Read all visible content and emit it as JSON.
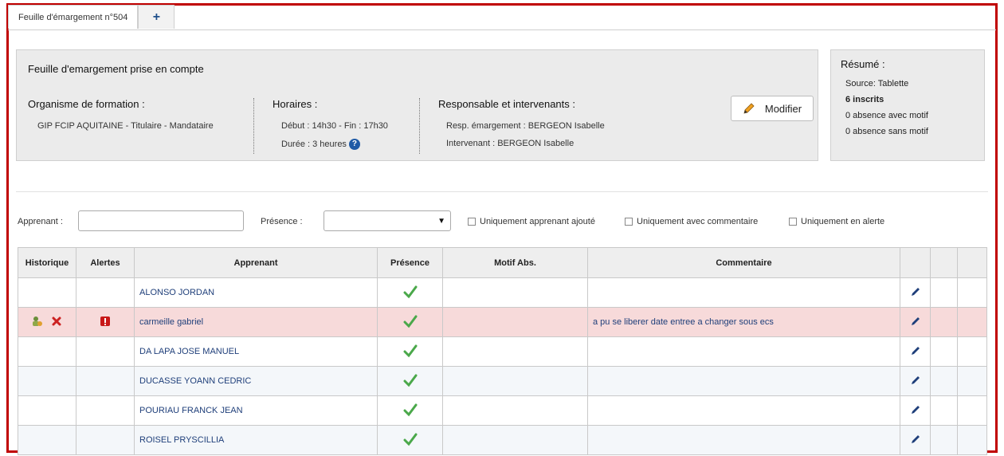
{
  "tabs": [
    {
      "label": "Feuille d'émargement n°504"
    },
    {
      "label": "+"
    }
  ],
  "info": {
    "title": "Feuille d'emargement prise en compte",
    "organisme": {
      "heading": "Organisme de formation :",
      "value": "GIP FCIP AQUITAINE - Titulaire - Mandataire"
    },
    "horaires": {
      "heading": "Horaires :",
      "debut_fin": "Début : 14h30 - Fin : 17h30",
      "duree": "Durée : 3 heures"
    },
    "responsable": {
      "heading": "Responsable et intervenants :",
      "resp": "Resp. émargement : BERGEON Isabelle",
      "intervenant": "Intervenant : BERGEON Isabelle"
    },
    "modify_label": "Modifier"
  },
  "summary": {
    "title": "Résumé :",
    "source": "Source: Tablette",
    "inscrits": "6 inscrits",
    "abs_motif": "0 absence avec motif",
    "abs_sans_motif": "0 absence sans motif"
  },
  "filters": {
    "apprenant_label": "Apprenant :",
    "apprenant_value": "",
    "presence_label": "Présence :",
    "presence_value": "",
    "check_ajoute": "Uniquement apprenant ajouté",
    "check_commentaire": "Uniquement avec commentaire",
    "check_alerte": "Uniquement en alerte"
  },
  "table": {
    "headers": [
      "Historique",
      "Alertes",
      "Apprenant",
      "Présence",
      "Motif Abs.",
      "Commentaire",
      "",
      "",
      ""
    ],
    "rows": [
      {
        "name": "ALONSO JORDAN",
        "comment": ""
      },
      {
        "name": "carmeille gabriel",
        "comment": "a pu se liberer date entree a changer sous ecs"
      },
      {
        "name": "DA LAPA JOSE MANUEL",
        "comment": ""
      },
      {
        "name": "DUCASSE YOANN CEDRIC",
        "comment": ""
      },
      {
        "name": "POURIAU FRANCK JEAN",
        "comment": ""
      },
      {
        "name": "ROISEL PRYSCILLIA",
        "comment": ""
      }
    ]
  },
  "colors": {
    "frame_border": "#c00000",
    "alert_row": "#f7dada",
    "check_green": "#4aa84a",
    "name_blue": "#1f3f7a"
  }
}
